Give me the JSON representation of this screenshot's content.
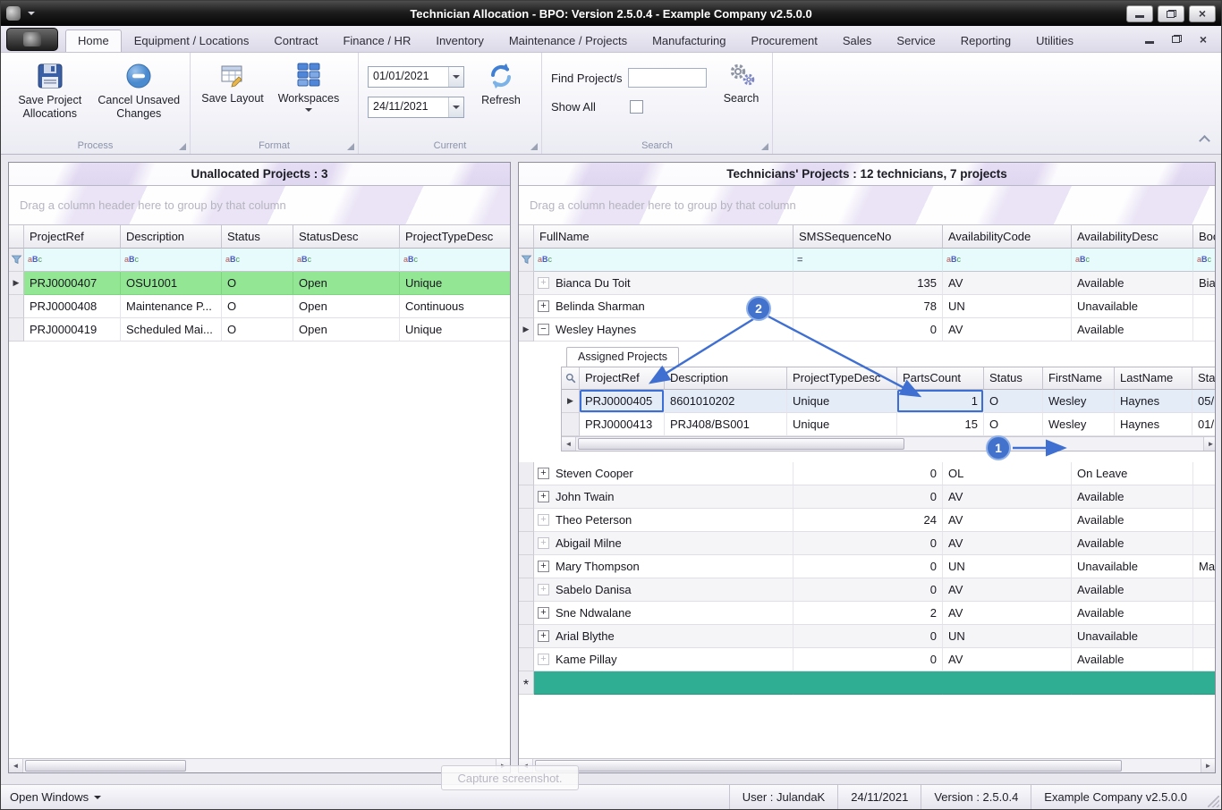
{
  "window": {
    "title": "Technician Allocation - BPO: Version 2.5.0.4 - Example Company v2.5.0.0"
  },
  "ribbon": {
    "tabs": [
      "Home",
      "Equipment / Locations",
      "Contract",
      "Finance / HR",
      "Inventory",
      "Maintenance / Projects",
      "Manufacturing",
      "Procurement",
      "Sales",
      "Service",
      "Reporting",
      "Utilities"
    ],
    "active_tab": "Home",
    "process": {
      "caption": "Process",
      "save_allocations": "Save Project Allocations",
      "cancel_changes": "Cancel Unsaved Changes"
    },
    "format": {
      "caption": "Format",
      "save_layout": "Save Layout",
      "workspaces": "Workspaces"
    },
    "current": {
      "caption": "Current",
      "date_from": "01/01/2021",
      "date_to": "24/11/2021",
      "refresh": "Refresh"
    },
    "search": {
      "caption": "Search",
      "find_label": "Find Project/s",
      "find_value": "",
      "show_all": "Show All",
      "show_all_checked": false,
      "button": "Search"
    }
  },
  "left_panel": {
    "title": "Unallocated Projects : 3",
    "group_hint": "Drag a column header here to group by that column",
    "columns": [
      "ProjectRef",
      "Description",
      "Status",
      "StatusDesc",
      "ProjectTypeDesc"
    ],
    "filter_icons": [
      "abc",
      "abc",
      "abc",
      "abc",
      "abc"
    ],
    "rows": [
      {
        "cells": [
          "PRJ0000407",
          "OSU1001",
          "O",
          "Open",
          "Unique"
        ],
        "state": "selected"
      },
      {
        "cells": [
          "PRJ0000408",
          "Maintenance P...",
          "O",
          "Open",
          "Continuous"
        ]
      },
      {
        "cells": [
          "PRJ0000419",
          "Scheduled Mai...",
          "O",
          "Open",
          "Unique"
        ]
      }
    ]
  },
  "right_panel": {
    "title": "Technicians' Projects : 12 technicians, 7 projects",
    "group_hint": "Drag a column header here to group by that column",
    "columns": [
      "FullName",
      "SMSSequenceNo",
      "AvailabilityCode",
      "AvailabilityDesc",
      "Boo"
    ],
    "filter_icons": [
      "abc",
      "eq",
      "abc",
      "abc",
      "abc"
    ],
    "rows": [
      {
        "cells": [
          "Bianca Du Toit",
          "135",
          "AV",
          "Available",
          "Bia"
        ],
        "expander": "plus-dim"
      },
      {
        "cells": [
          "Belinda Sharman",
          "78",
          "UN",
          "Unavailable",
          ""
        ],
        "expander": "plus"
      },
      {
        "cells": [
          "Wesley Haynes",
          "0",
          "AV",
          "Available",
          ""
        ],
        "expander": "minus",
        "current": true,
        "expanded": true
      },
      {
        "cells": [
          "Steven Cooper",
          "0",
          "OL",
          "On Leave",
          ""
        ],
        "expander": "plus"
      },
      {
        "cells": [
          "John Twain",
          "0",
          "AV",
          "Available",
          ""
        ],
        "expander": "plus"
      },
      {
        "cells": [
          "Theo Peterson",
          "24",
          "AV",
          "Available",
          ""
        ],
        "expander": "plus-dim"
      },
      {
        "cells": [
          "Abigail Milne",
          "0",
          "AV",
          "Available",
          ""
        ],
        "expander": "plus-dim"
      },
      {
        "cells": [
          "Mary Thompson",
          "0",
          "UN",
          "Unavailable",
          "Ma"
        ],
        "expander": "plus"
      },
      {
        "cells": [
          "Sabelo Danisa",
          "0",
          "AV",
          "Available",
          ""
        ],
        "expander": "plus-dim"
      },
      {
        "cells": [
          "Sne Ndwalane",
          "2",
          "AV",
          "Available",
          ""
        ],
        "expander": "plus"
      },
      {
        "cells": [
          "Arial Blythe",
          "0",
          "UN",
          "Unavailable",
          ""
        ],
        "expander": "plus"
      },
      {
        "cells": [
          "Kame Pillay",
          "0",
          "AV",
          "Available",
          ""
        ],
        "expander": "plus-dim"
      }
    ],
    "detail": {
      "tab": "Assigned Projects",
      "columns": [
        "ProjectRef",
        "Description",
        "ProjectTypeDesc",
        "PartsCount",
        "Status",
        "FirstName",
        "LastName",
        "Sta"
      ],
      "rows": [
        {
          "cells": [
            "PRJ0000405",
            "8601010202",
            "Unique",
            "1",
            "O",
            "Wesley",
            "Haynes",
            "05/"
          ],
          "current": true,
          "highlight": [
            0,
            3
          ]
        },
        {
          "cells": [
            "PRJ0000413",
            "PRJ408/BS001",
            "Unique",
            "15",
            "O",
            "Wesley",
            "Haynes",
            "01/"
          ]
        }
      ]
    }
  },
  "status_bar": {
    "open_windows": "Open Windows",
    "items": [
      "User : JulandaK",
      "24/11/2021",
      "Version : 2.5.0.4",
      "Example Company v2.5.0.0"
    ]
  },
  "tooltip": "Capture screenshot.",
  "callouts": {
    "one": "1",
    "two": "2"
  },
  "colors": {
    "accent_blue": "#3f6fd1",
    "selected_green": "#93e693",
    "new_row_teal": "#2fae93",
    "filter_row_cyan": "#e7fbfc"
  }
}
